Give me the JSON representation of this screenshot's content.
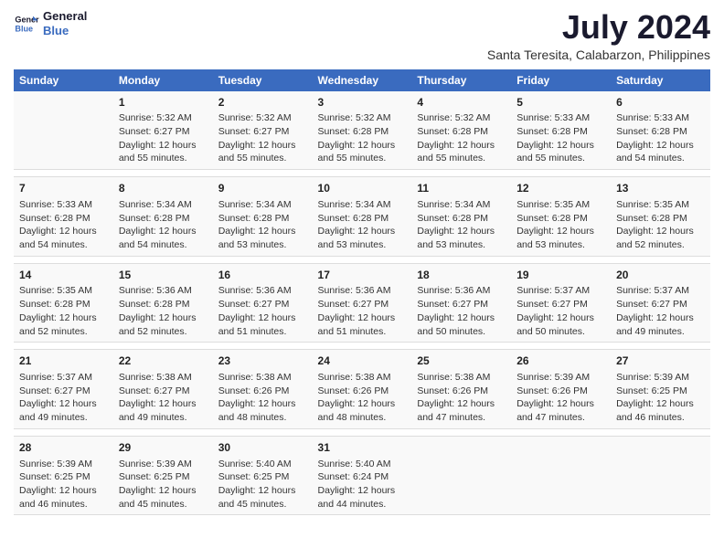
{
  "header": {
    "logo_line1": "General",
    "logo_line2": "Blue",
    "title": "July 2024",
    "subtitle": "Santa Teresita, Calabarzon, Philippines"
  },
  "columns": [
    "Sunday",
    "Monday",
    "Tuesday",
    "Wednesday",
    "Thursday",
    "Friday",
    "Saturday"
  ],
  "weeks": [
    [
      {
        "day": "",
        "text": ""
      },
      {
        "day": "1",
        "text": "Sunrise: 5:32 AM\nSunset: 6:27 PM\nDaylight: 12 hours\nand 55 minutes."
      },
      {
        "day": "2",
        "text": "Sunrise: 5:32 AM\nSunset: 6:27 PM\nDaylight: 12 hours\nand 55 minutes."
      },
      {
        "day": "3",
        "text": "Sunrise: 5:32 AM\nSunset: 6:28 PM\nDaylight: 12 hours\nand 55 minutes."
      },
      {
        "day": "4",
        "text": "Sunrise: 5:32 AM\nSunset: 6:28 PM\nDaylight: 12 hours\nand 55 minutes."
      },
      {
        "day": "5",
        "text": "Sunrise: 5:33 AM\nSunset: 6:28 PM\nDaylight: 12 hours\nand 55 minutes."
      },
      {
        "day": "6",
        "text": "Sunrise: 5:33 AM\nSunset: 6:28 PM\nDaylight: 12 hours\nand 54 minutes."
      }
    ],
    [
      {
        "day": "7",
        "text": "Sunrise: 5:33 AM\nSunset: 6:28 PM\nDaylight: 12 hours\nand 54 minutes."
      },
      {
        "day": "8",
        "text": "Sunrise: 5:34 AM\nSunset: 6:28 PM\nDaylight: 12 hours\nand 54 minutes."
      },
      {
        "day": "9",
        "text": "Sunrise: 5:34 AM\nSunset: 6:28 PM\nDaylight: 12 hours\nand 53 minutes."
      },
      {
        "day": "10",
        "text": "Sunrise: 5:34 AM\nSunset: 6:28 PM\nDaylight: 12 hours\nand 53 minutes."
      },
      {
        "day": "11",
        "text": "Sunrise: 5:34 AM\nSunset: 6:28 PM\nDaylight: 12 hours\nand 53 minutes."
      },
      {
        "day": "12",
        "text": "Sunrise: 5:35 AM\nSunset: 6:28 PM\nDaylight: 12 hours\nand 53 minutes."
      },
      {
        "day": "13",
        "text": "Sunrise: 5:35 AM\nSunset: 6:28 PM\nDaylight: 12 hours\nand 52 minutes."
      }
    ],
    [
      {
        "day": "14",
        "text": "Sunrise: 5:35 AM\nSunset: 6:28 PM\nDaylight: 12 hours\nand 52 minutes."
      },
      {
        "day": "15",
        "text": "Sunrise: 5:36 AM\nSunset: 6:28 PM\nDaylight: 12 hours\nand 52 minutes."
      },
      {
        "day": "16",
        "text": "Sunrise: 5:36 AM\nSunset: 6:27 PM\nDaylight: 12 hours\nand 51 minutes."
      },
      {
        "day": "17",
        "text": "Sunrise: 5:36 AM\nSunset: 6:27 PM\nDaylight: 12 hours\nand 51 minutes."
      },
      {
        "day": "18",
        "text": "Sunrise: 5:36 AM\nSunset: 6:27 PM\nDaylight: 12 hours\nand 50 minutes."
      },
      {
        "day": "19",
        "text": "Sunrise: 5:37 AM\nSunset: 6:27 PM\nDaylight: 12 hours\nand 50 minutes."
      },
      {
        "day": "20",
        "text": "Sunrise: 5:37 AM\nSunset: 6:27 PM\nDaylight: 12 hours\nand 49 minutes."
      }
    ],
    [
      {
        "day": "21",
        "text": "Sunrise: 5:37 AM\nSunset: 6:27 PM\nDaylight: 12 hours\nand 49 minutes."
      },
      {
        "day": "22",
        "text": "Sunrise: 5:38 AM\nSunset: 6:27 PM\nDaylight: 12 hours\nand 49 minutes."
      },
      {
        "day": "23",
        "text": "Sunrise: 5:38 AM\nSunset: 6:26 PM\nDaylight: 12 hours\nand 48 minutes."
      },
      {
        "day": "24",
        "text": "Sunrise: 5:38 AM\nSunset: 6:26 PM\nDaylight: 12 hours\nand 48 minutes."
      },
      {
        "day": "25",
        "text": "Sunrise: 5:38 AM\nSunset: 6:26 PM\nDaylight: 12 hours\nand 47 minutes."
      },
      {
        "day": "26",
        "text": "Sunrise: 5:39 AM\nSunset: 6:26 PM\nDaylight: 12 hours\nand 47 minutes."
      },
      {
        "day": "27",
        "text": "Sunrise: 5:39 AM\nSunset: 6:25 PM\nDaylight: 12 hours\nand 46 minutes."
      }
    ],
    [
      {
        "day": "28",
        "text": "Sunrise: 5:39 AM\nSunset: 6:25 PM\nDaylight: 12 hours\nand 46 minutes."
      },
      {
        "day": "29",
        "text": "Sunrise: 5:39 AM\nSunset: 6:25 PM\nDaylight: 12 hours\nand 45 minutes."
      },
      {
        "day": "30",
        "text": "Sunrise: 5:40 AM\nSunset: 6:25 PM\nDaylight: 12 hours\nand 45 minutes."
      },
      {
        "day": "31",
        "text": "Sunrise: 5:40 AM\nSunset: 6:24 PM\nDaylight: 12 hours\nand 44 minutes."
      },
      {
        "day": "",
        "text": ""
      },
      {
        "day": "",
        "text": ""
      },
      {
        "day": "",
        "text": ""
      }
    ]
  ]
}
